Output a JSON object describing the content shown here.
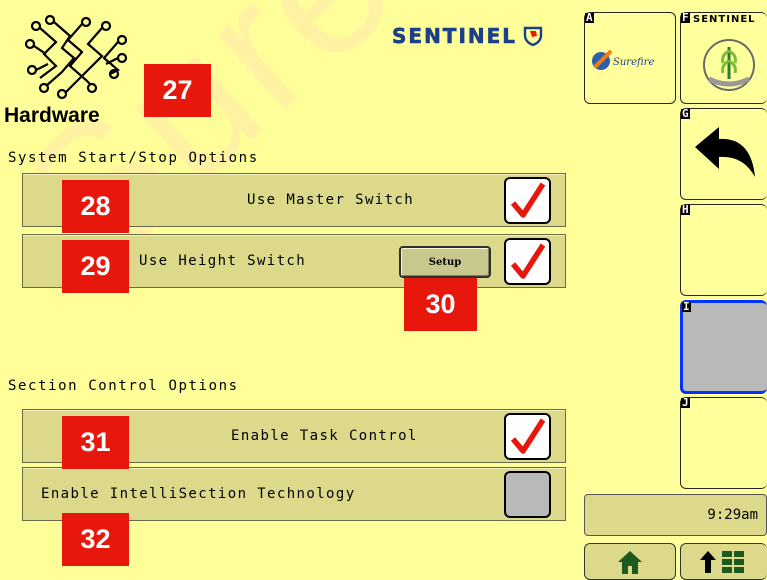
{
  "header": {
    "brand_text": "SENTINEL",
    "page_title": "Hardware"
  },
  "system_section": {
    "label": "System Start/Stop Options",
    "rows": [
      {
        "label": "Use Master Switch",
        "checked": true
      },
      {
        "label": "Use Height Switch",
        "checked": true,
        "setup_label": "Setup"
      }
    ]
  },
  "section_control": {
    "label": "Section Control Options",
    "rows": [
      {
        "label": "Enable Task Control",
        "checked": true
      },
      {
        "label": "Enable IntelliSection Technology",
        "checked": false
      }
    ]
  },
  "callouts": [
    "27",
    "28",
    "29",
    "30",
    "31",
    "32"
  ],
  "softkeys": {
    "a": {
      "letter": "A",
      "icon": "surefire-logo-icon",
      "logo_text": "Surefire"
    },
    "f": {
      "letter": "F",
      "icon": "sentinel-wheat-logo-icon",
      "logo_text": "SENTINEL"
    },
    "g": {
      "letter": "G",
      "icon": "back-arrow-icon"
    },
    "h": {
      "letter": "H"
    },
    "i": {
      "letter": "I",
      "selected": true
    },
    "j": {
      "letter": "J"
    }
  },
  "status": {
    "time": "9:29am"
  },
  "bottom_buttons": [
    {
      "icon": "home-icon"
    },
    {
      "icon": "up-arrow-grid-icon"
    }
  ],
  "watermark_text": "SurePoint",
  "colors": {
    "background": "#ffff99",
    "row_fill": "#dcd98a",
    "check_red": "#e8170c",
    "callout_red": "#e8170c",
    "brand_blue": "#1c3f8c",
    "selected_border": "#0033ff",
    "selected_fill": "#b9b9b9"
  }
}
